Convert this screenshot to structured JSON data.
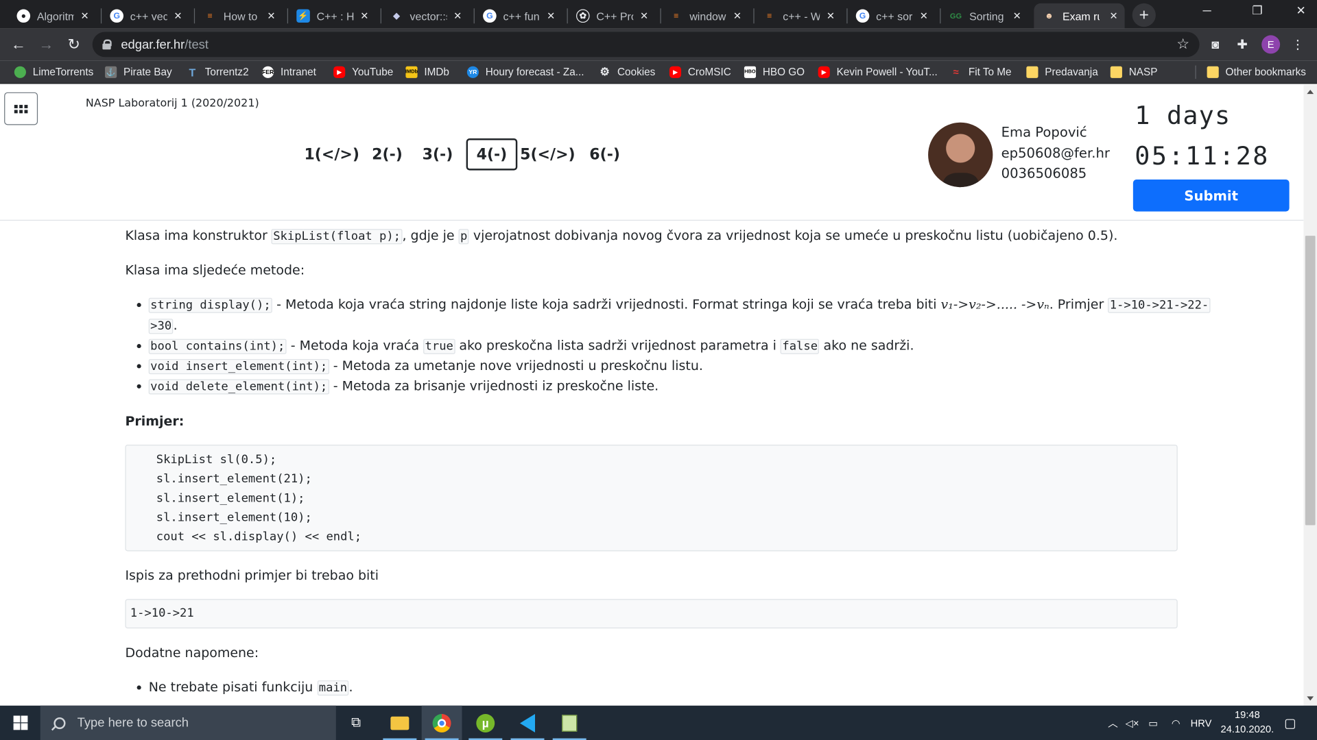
{
  "browser": {
    "tabs": [
      {
        "label": "Algoritm",
        "icon": "github-icon"
      },
      {
        "label": "c++ vec",
        "icon": "google-icon"
      },
      {
        "label": "How to",
        "icon": "stackoverflow-icon"
      },
      {
        "label": "C++ : H",
        "icon": "cpp-tutorial-icon"
      },
      {
        "label": "vector::s",
        "icon": "cplusplus-icon"
      },
      {
        "label": "c++ fun",
        "icon": "google-icon"
      },
      {
        "label": "C++ Pro",
        "icon": "openai-icon"
      },
      {
        "label": "window",
        "icon": "stackoverflow-icon"
      },
      {
        "label": "c++ - W",
        "icon": "stackoverflow-icon"
      },
      {
        "label": "c++ sor",
        "icon": "google-icon"
      },
      {
        "label": "Sorting",
        "icon": "geeksforgeeks-icon"
      },
      {
        "label": "Exam ru",
        "icon": "exam-icon"
      }
    ],
    "address": {
      "host": "edgar.fer.hr",
      "path": "/test"
    },
    "profile_initial": "E",
    "bookmarks": [
      {
        "label": "LimeTorrents",
        "color": "#4caf50"
      },
      {
        "label": "Pirate Bay",
        "color": "#9e9e9e"
      },
      {
        "label": "Torrentz2",
        "color": "#3f6ea8"
      },
      {
        "label": "Intranet",
        "color": "#ffffff"
      },
      {
        "label": "YouTube",
        "color": "#ff0000"
      },
      {
        "label": "IMDb",
        "color": "#f5c518"
      },
      {
        "label": "Houry forecast - Za...",
        "color": "#1e88e5"
      },
      {
        "label": "Cookies",
        "color": "#e0e0e0"
      },
      {
        "label": "CroMSIC",
        "color": "#ff0000"
      },
      {
        "label": "HBO GO",
        "color": "#ffffff"
      },
      {
        "label": "Kevin Powell - YouT...",
        "color": "#ff0000"
      },
      {
        "label": "Fit To Me",
        "color": "#e53935"
      },
      {
        "label": "Predavanja",
        "color": "#fdd663"
      },
      {
        "label": "NASP",
        "color": "#fdd663"
      }
    ],
    "other_bookmarks": "Other bookmarks"
  },
  "header": {
    "course": "NASP Laboratorij 1 (2020/2021)",
    "questions": [
      "1(</>)",
      "2(-)",
      "3(-)",
      "4(-)",
      "5(</>)",
      "6(-)"
    ],
    "user": {
      "name": "Ema Popović",
      "email": "ep50608@fer.hr",
      "jmbag": "0036506085"
    },
    "timer": {
      "days": "1 days",
      "time": "05:11:28"
    },
    "submit": "Submit"
  },
  "content": {
    "p1": {
      "a": "Klasa ima konstruktor ",
      "code1": "SkipList(float p);",
      "b": ", gdje je ",
      "code2": "p",
      "c": " vjerojatnost dobivanja novog čvora za vrijednost koja se umeće u preskočnu listu (uobičajeno 0.5)."
    },
    "p2": "Klasa ima sljedeće metode:",
    "methods": [
      {
        "code": "string display();",
        "text": " - Metoda koja vraća string najdonje liste koja sadrži vrijednosti. Format stringa koji se vraća treba biti ",
        "math": "v₁->v₂->..... ->vₙ",
        "text2": ". Primjer ",
        "code2": "1->10->21->22-",
        "line2": ">30",
        "tail": "."
      },
      {
        "code": "bool contains(int);",
        "text": " - Metoda koja vraća ",
        "code2": "true",
        "text2": " ako preskočna lista sadrži vrijednost parametra i ",
        "code3": "false",
        "text3": " ako ne sadrži."
      },
      {
        "code": "void insert_element(int);",
        "text": " - Metoda za umetanje nove vrijednosti u preskočnu listu."
      },
      {
        "code": "void delete_element(int);",
        "text": " - Metoda za brisanje vrijednosti iz preskočne liste."
      }
    ],
    "example_title": "Primjer:",
    "example_code": [
      "SkipList sl(0.5);",
      "sl.insert_element(21);",
      "sl.insert_element(1);",
      "sl.insert_element(10);",
      "cout << sl.display() << endl;"
    ],
    "output_label": "Ispis za prethodni primjer bi trebao biti",
    "output": "1->10->21",
    "notes_label": "Dodatne napomene:",
    "note1": {
      "text": "Ne trebate pisati funkciju ",
      "code": "main",
      "tail": "."
    }
  },
  "taskbar": {
    "search_placeholder": "Type here to search",
    "lang": "HRV",
    "time": "19:48",
    "date": "24.10.2020."
  }
}
